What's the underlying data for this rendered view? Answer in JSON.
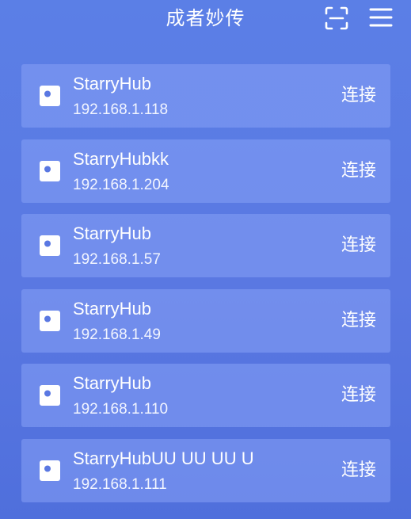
{
  "header": {
    "title": "成者妙传",
    "scan_icon": "scan-icon",
    "menu_icon": "menu-icon"
  },
  "devices": [
    {
      "name": "StarryHub",
      "ip": "192.168.1.118",
      "action": "连接"
    },
    {
      "name": "StarryHubkk",
      "ip": "192.168.1.204",
      "action": "连接"
    },
    {
      "name": "StarryHub",
      "ip": "192.168.1.57",
      "action": "连接"
    },
    {
      "name": "StarryHub",
      "ip": "192.168.1.49",
      "action": "连接"
    },
    {
      "name": "StarryHub",
      "ip": "192.168.1.110",
      "action": "连接"
    },
    {
      "name": "StarryHubUU UU UU U",
      "ip": "192.168.1.111",
      "action": "连接"
    }
  ],
  "device_icon": "device-icon",
  "colors": {
    "background": "#5a78e2",
    "card": "#7d98ee",
    "text": "#ffffff"
  }
}
